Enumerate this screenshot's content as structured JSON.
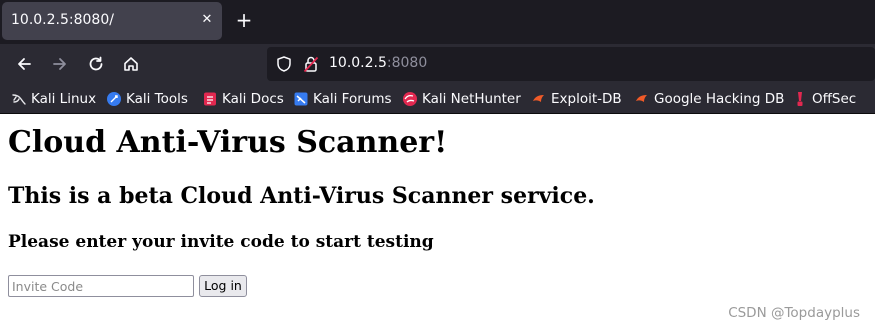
{
  "browser": {
    "tab": {
      "title": "10.0.2.5:8080/",
      "close_icon": "close-icon"
    },
    "new_tab_icon": "plus-icon",
    "nav": {
      "back_icon": "arrow-left-icon",
      "forward_icon": "arrow-right-icon",
      "reload_icon": "reload-icon",
      "home_icon": "home-icon"
    },
    "url": {
      "host": "10.0.2.5",
      "port": ":8080"
    },
    "bookmarks": [
      {
        "label": "Kali Linux",
        "icon": "kali-dragon-icon"
      },
      {
        "label": "Kali Tools",
        "icon": "kali-tools-icon"
      },
      {
        "label": "Kali Docs",
        "icon": "kali-docs-icon"
      },
      {
        "label": "Kali Forums",
        "icon": "kali-forums-icon"
      },
      {
        "label": "Kali NetHunter",
        "icon": "nethunter-icon"
      },
      {
        "label": "Exploit-DB",
        "icon": "exploit-db-icon"
      },
      {
        "label": "Google Hacking DB",
        "icon": "ghdb-icon"
      },
      {
        "label": "OffSec",
        "icon": "offsec-icon"
      }
    ]
  },
  "page": {
    "heading1": "Cloud Anti-Virus Scanner!",
    "heading2": "This is a beta Cloud Anti-Virus Scanner service.",
    "heading3": "Please enter your invite code to start testing",
    "invite_placeholder": "Invite Code",
    "invite_value": "",
    "login_label": "Log in"
  },
  "watermark": "CSDN @Topdayplus",
  "colors": {
    "tabstrip_bg": "#1c1b22",
    "toolbar_bg": "#2b2a33",
    "active_tab_bg": "#42414d",
    "urlbar_bg": "#1c1b22",
    "accent_red": "#e22850"
  }
}
